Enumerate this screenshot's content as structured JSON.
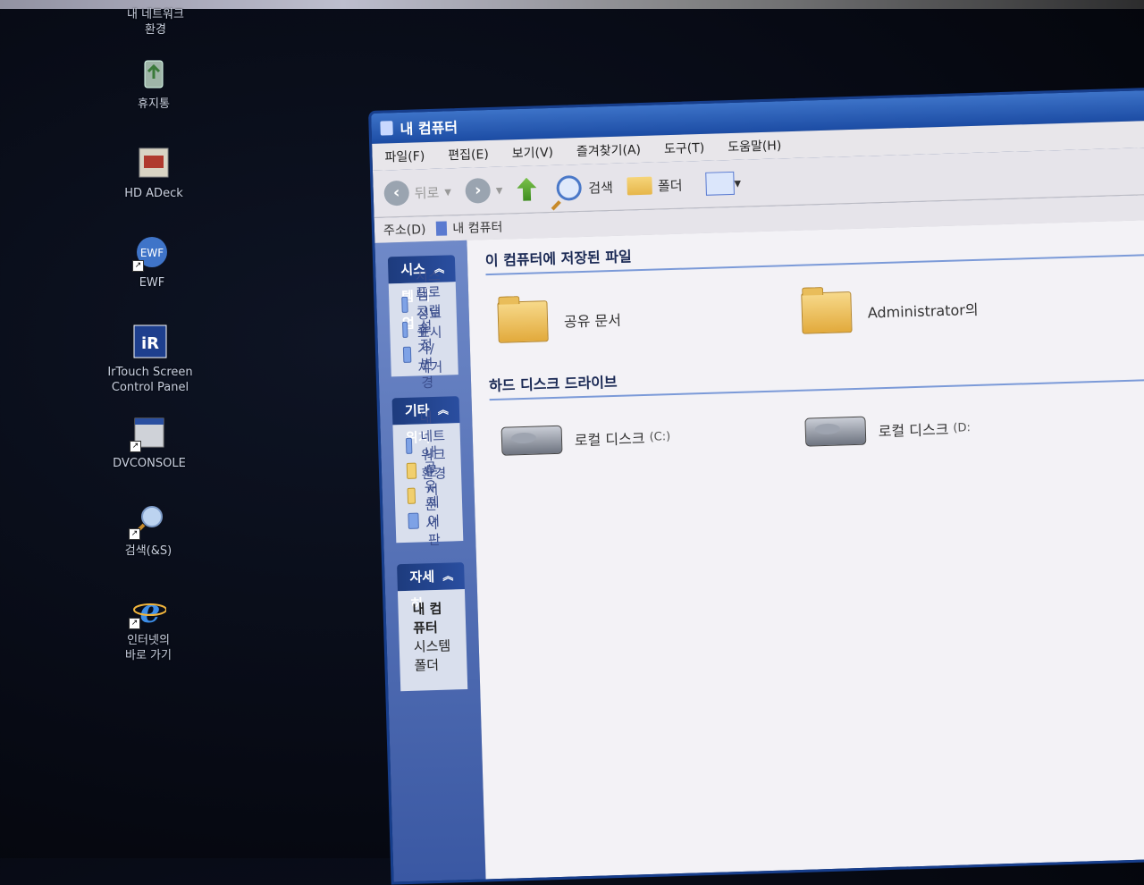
{
  "desktop_icons": [
    {
      "label": "내 네트워크\n환경",
      "icon": "network-icon"
    },
    {
      "label": "휴지통",
      "icon": "recycle-bin-icon"
    },
    {
      "label": "HD ADeck",
      "icon": "app-icon"
    },
    {
      "label": "EWF",
      "icon": "ewf-icon",
      "badge": "EWF"
    },
    {
      "label": "IrTouch Screen\nControl Panel",
      "icon": "irtouch-icon",
      "badge": "iR"
    },
    {
      "label": "DVCONSOLE",
      "icon": "console-icon"
    },
    {
      "label": "검색(&S)",
      "icon": "search-icon"
    },
    {
      "label": "인터넷의\n바로 가기",
      "icon": "internet-explorer-icon"
    }
  ],
  "window": {
    "title": "내 컴퓨터",
    "menu": [
      "파일(F)",
      "편집(E)",
      "보기(V)",
      "즐겨찾기(A)",
      "도구(T)",
      "도움말(H)"
    ],
    "toolbar": {
      "back": "뒤로",
      "search": "검색",
      "folders": "폴더"
    },
    "address": {
      "label": "주소(D)",
      "value": "내 컴퓨터"
    }
  },
  "tasks": {
    "system": {
      "title": "시스템 작업",
      "items": [
        "시스템 정보 표시",
        "프로그램 추가/제거",
        "설정 변경"
      ]
    },
    "other": {
      "title": "기타 위치",
      "items": [
        "내 네트워크 환경",
        "내 문서",
        "공유 문서",
        "제어판"
      ]
    },
    "details": {
      "title": "자세히",
      "name": "내 컴퓨터",
      "type": "시스템 폴더"
    }
  },
  "main": {
    "files_section": {
      "title": "이 컴퓨터에 저장된 파일",
      "items": [
        "공유 문서",
        "Administrator의"
      ]
    },
    "drives_section": {
      "title": "하드 디스크 드라이브",
      "items": [
        {
          "name": "로컬 디스크",
          "suffix": "(C:)"
        },
        {
          "name": "로컬 디스크",
          "suffix": "(D:"
        }
      ]
    }
  }
}
